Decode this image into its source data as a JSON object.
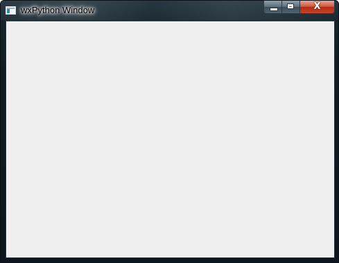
{
  "window": {
    "title": "wxPython Window",
    "icon": "app-window-icon",
    "frame_color": "#15232c",
    "client_background": "#f0f0f0",
    "close_button_color": "#c8432a"
  },
  "caption_buttons": {
    "minimize_icon": "minimize-icon",
    "maximize_icon": "maximize-icon",
    "close_glyph": "X"
  }
}
